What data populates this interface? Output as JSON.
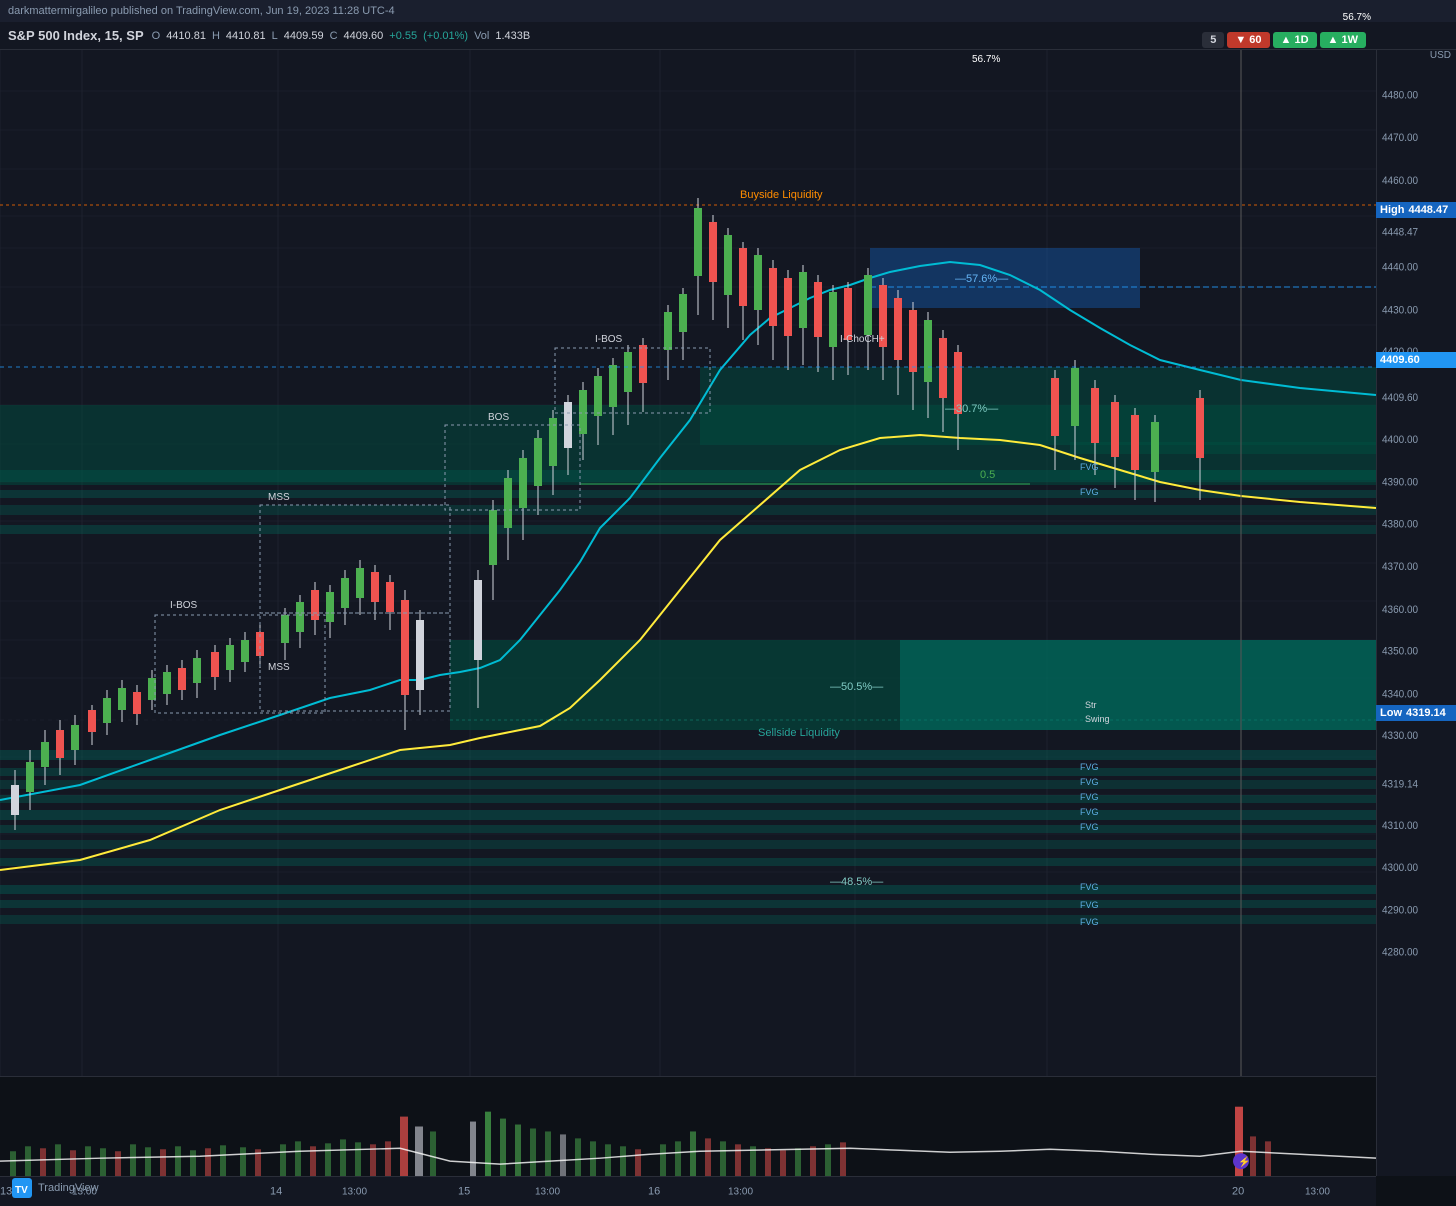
{
  "header": {
    "published_text": "darkmattermirgalileo published on TradingView.com, Jun 19, 2023 11:28 UTC-4"
  },
  "instrument": {
    "name": "S&P 500 Index, 15, SP",
    "open_label": "O",
    "open_val": "4410.81",
    "high_label": "H",
    "high_val": "4410.81",
    "low_label": "L",
    "low_val": "4409.59",
    "close_label": "C",
    "close_val": "4409.60",
    "change": "+0.55",
    "change_pct": "(+0.01%)",
    "vol_label": "Vol",
    "vol_val": "1.433B"
  },
  "timeframes": [
    {
      "label": "5",
      "style": "neutral"
    },
    {
      "label": "▼ 60",
      "style": "red"
    },
    {
      "label": "▲ 1D",
      "style": "green"
    },
    {
      "label": "▲ 1W",
      "style": "green"
    }
  ],
  "currency": "USD",
  "price_labels": {
    "high": {
      "label": "High",
      "value": "4448.47"
    },
    "low": {
      "label": "Low",
      "value": "4319.14"
    },
    "current": {
      "value": "4409.60"
    }
  },
  "price_ticks": [
    {
      "price": 4480,
      "pct_from_top": 4.0
    },
    {
      "price": 4470,
      "pct_from_top": 7.8
    },
    {
      "price": 4460,
      "pct_from_top": 11.6
    },
    {
      "price": 4448.47,
      "pct_from_top": 16.1
    },
    {
      "price": 4440,
      "pct_from_top": 19.3
    },
    {
      "price": 4430,
      "pct_from_top": 23.1
    },
    {
      "price": 4420,
      "pct_from_top": 26.9
    },
    {
      "price": 4409.6,
      "pct_from_top": 30.9
    },
    {
      "price": 4400,
      "pct_from_top": 34.6
    },
    {
      "price": 4390,
      "pct_from_top": 38.4
    },
    {
      "price": 4380,
      "pct_from_top": 42.3
    },
    {
      "price": 4370,
      "pct_from_top": 46.1
    },
    {
      "price": 4360,
      "pct_from_top": 50.0
    },
    {
      "price": 4350,
      "pct_from_top": 53.8
    },
    {
      "price": 4340,
      "pct_from_top": 57.6
    },
    {
      "price": 4330,
      "pct_from_top": 61.4
    },
    {
      "price": 4319.14,
      "pct_from_top": 65.5
    },
    {
      "price": 4310,
      "pct_from_top": 68.9
    },
    {
      "price": 4300,
      "pct_from_top": 72.7
    },
    {
      "price": 4290,
      "pct_from_top": 76.5
    },
    {
      "price": 4280,
      "pct_from_top": 80.4
    }
  ],
  "x_axis_labels": [
    "13",
    "13:00",
    "14",
    "13:00",
    "15",
    "13:00",
    "16",
    "13:00",
    "20",
    "13:00"
  ],
  "annotations": {
    "i_bos_1": "I-BOS",
    "mss_1": "MSS",
    "mss_2": "MSS",
    "bos": "BOS",
    "i_bos_2": "I-BOS",
    "i_choch": "I-ChoCH+",
    "buyside_liq": "Buyside Liquidity",
    "sellside_liq": "Sellside Liquidity",
    "fvg": "FVG",
    "pct_576": "-57.6%",
    "pct_307": "-30.7%",
    "pct_505": "-50.5%",
    "pct_485": "-48.5%",
    "pct_05": "0.5",
    "pct_567": "56.7%",
    "str": "Str",
    "swing": "Swing"
  },
  "colors": {
    "background": "#0d1117",
    "chart_bg": "#131722",
    "grid": "#1e2330",
    "candle_up": "#d1d4dc",
    "candle_down": "#d1d4dc",
    "ema_cyan": "#00bcd4",
    "ema_yellow": "#ffeb3b",
    "fvg_green": "#00897b",
    "fvg_green_light": "#26a69a",
    "buyside_orange": "#ff6d00",
    "sellside_teal": "#00bfa5",
    "high_label_bg": "#1565c0",
    "low_label_bg": "#1565c0",
    "current_label_bg": "#2196f3",
    "accent_blue": "#1565c0",
    "tf_red": "#c0392b",
    "tf_green": "#27ae60"
  },
  "tradingview": {
    "logo_text": "TradingView"
  }
}
